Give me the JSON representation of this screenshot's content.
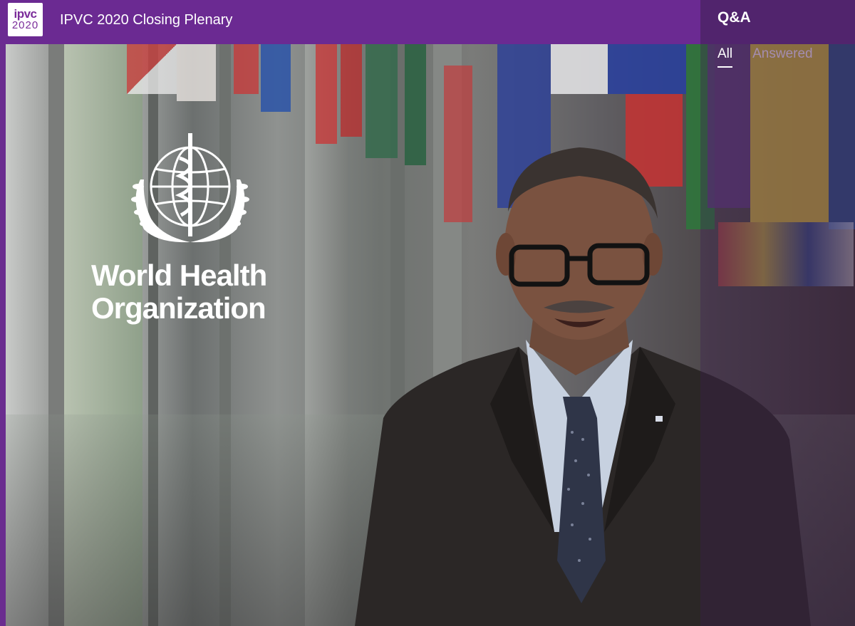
{
  "header": {
    "logo": {
      "line1": "ipvc",
      "line2": "2020"
    },
    "title": "IPVC 2020 Closing Plenary"
  },
  "qa_panel": {
    "title": "Q&A",
    "tabs": [
      {
        "label": "All",
        "active": true
      },
      {
        "label": "Answered",
        "active": false
      }
    ]
  },
  "video": {
    "overlay_logo": {
      "line1": "World Health",
      "line2": "Organization"
    }
  },
  "colors": {
    "header_bg": "#6b2a92",
    "qa_header_bg": "#51246d",
    "tab_inactive": "#a48db1",
    "tab_active": "#ffffff"
  }
}
